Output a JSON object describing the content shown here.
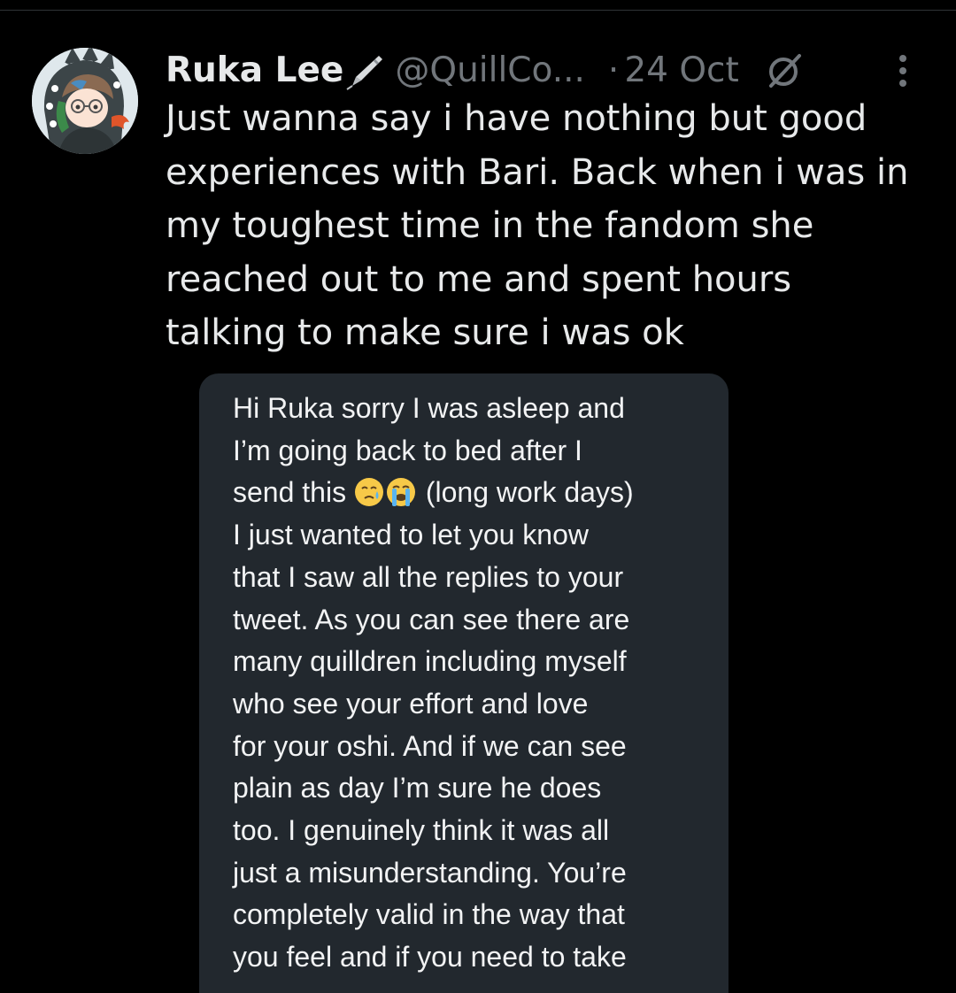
{
  "tweet": {
    "author_name": "Ruka Lee",
    "handle": "@QuillCo...",
    "separator": "·",
    "date": "24 Oct",
    "text": "Just wanna say i have nothing but good\nexperiences with Bari. Back when i was in\nmy toughest time in the fandom she\nreached out to me and spent hours\ntalking to make sure i was ok",
    "icons": {
      "name_emoji": "fountain-pen-icon",
      "grok": "grok-icon",
      "more": "more-vertical-icon"
    }
  },
  "media": {
    "message_lines": [
      "Hi Ruka sorry I was asleep and",
      "I’m going back to bed after I",
      "(long work days)",
      "I just wanted to let you know",
      "that I saw all the replies to your",
      "tweet. As you can see there are",
      "many quilldren including myself",
      "who see your effort and love",
      "for your oshi. And if we can see",
      "plain as day I’m sure he does",
      "too. I genuinely think it was all",
      "just a misunderstanding. You’re",
      "completely valid in the way that",
      "you feel and if you need to take"
    ],
    "line3_prefix": "send this",
    "emojis": [
      "face-with-tear-emoji",
      "loudly-crying-emoji"
    ]
  },
  "colors": {
    "background": "#000000",
    "primary_text": "#e7e9ea",
    "secondary_text": "#71767b",
    "card_background": "#22282e"
  }
}
